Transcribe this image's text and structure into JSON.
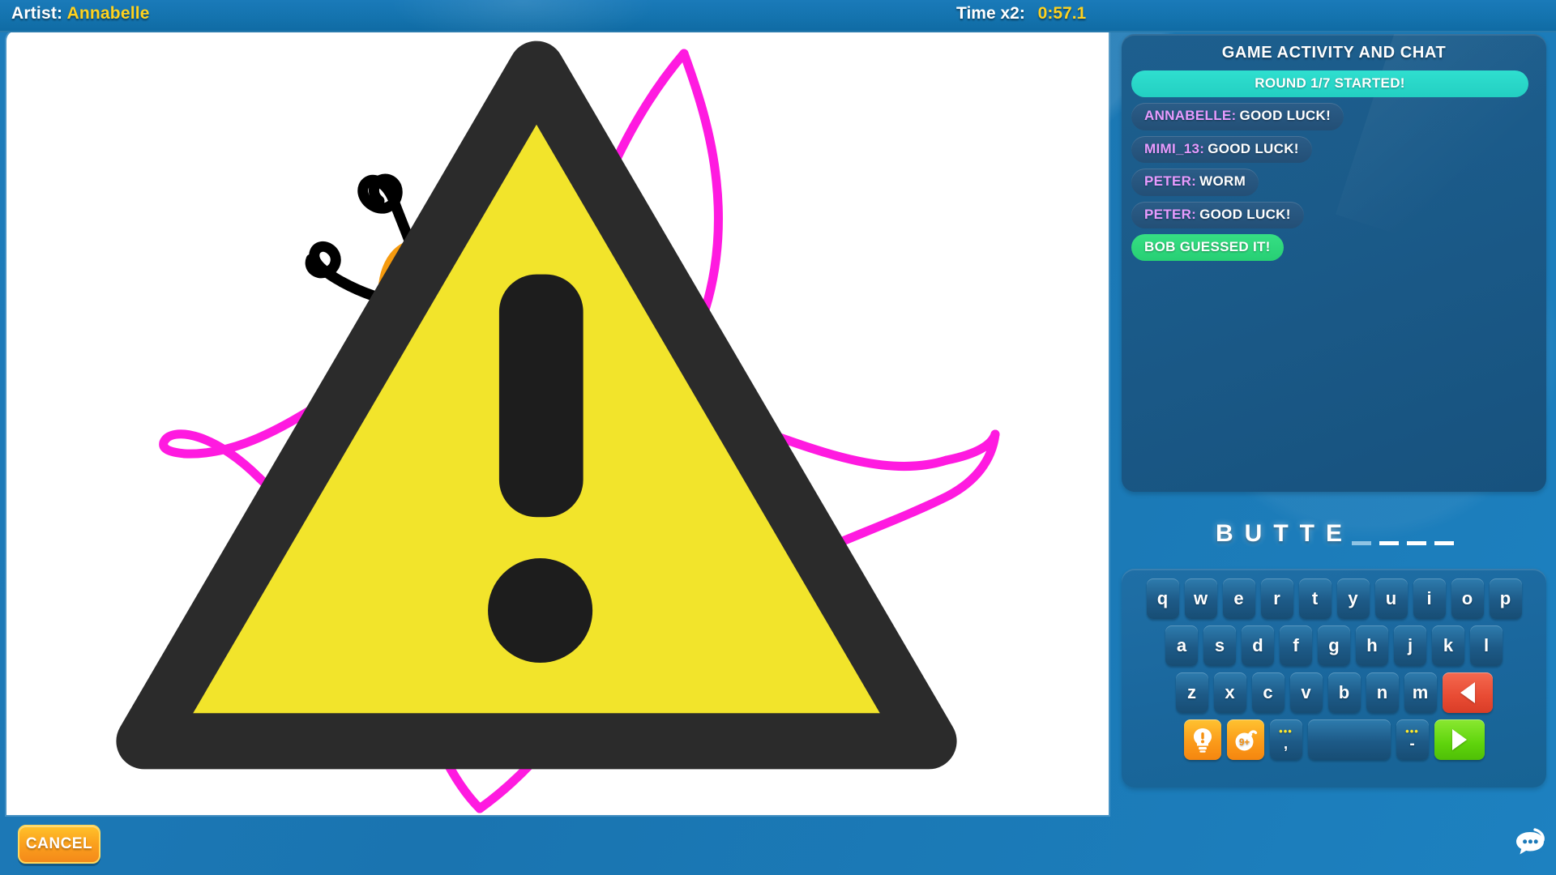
{
  "topbar": {
    "artist_label": "Artist:",
    "artist_name": "Annabelle",
    "time_label": "Time x2:",
    "time_value": "0:57.1"
  },
  "canvas": {
    "warning_icon": "warning-triangle-icon",
    "drawing_subject": "butterfly",
    "colors": {
      "wings": "#ff1ae0",
      "body": "#1ee3f0",
      "head": "#f59a0e",
      "antennae": "#000000",
      "segments": "#f59a0e",
      "background": "#ffffff"
    }
  },
  "cancel": {
    "label": "CANCEL"
  },
  "chat": {
    "title": "GAME ACTIVITY AND CHAT",
    "messages": [
      {
        "type": "system",
        "who": "",
        "text": "ROUND 1/7 STARTED!"
      },
      {
        "type": "msg",
        "who": "ANNABELLE:",
        "text": "GOOD LUCK!"
      },
      {
        "type": "msg",
        "who": "MIMI_13:",
        "text": "GOOD LUCK!"
      },
      {
        "type": "msg",
        "who": "PETER:",
        "text": "WORM"
      },
      {
        "type": "msg",
        "who": "PETER:",
        "text": "GOOD LUCK!"
      },
      {
        "type": "success",
        "who": "",
        "text": "BOB GUESSED IT!"
      }
    ],
    "colors": {
      "system": "#2bd8c9",
      "success": "#2fd87c",
      "username": "#e79bff"
    }
  },
  "word": {
    "revealed": [
      "B",
      "U",
      "T",
      "T",
      "E"
    ],
    "blanks": 4,
    "active_blank_index": 0
  },
  "keyboard": {
    "row1": [
      "q",
      "w",
      "e",
      "r",
      "t",
      "y",
      "u",
      "i",
      "o",
      "p"
    ],
    "row2": [
      "a",
      "s",
      "d",
      "f",
      "g",
      "h",
      "j",
      "k",
      "l"
    ],
    "row3": [
      "z",
      "x",
      "c",
      "v",
      "b",
      "n",
      "m"
    ],
    "backspace_icon": "backspace-triangle-icon",
    "hint_icon": "lightbulb-hint-icon",
    "bomb_label": "9+",
    "bomb_icon": "bomb-icon",
    "comma_key": ",",
    "comma_dots": "•••",
    "space_label": "",
    "hyphen_key": "-",
    "hyphen_dots": "•••",
    "enter_icon": "submit-triangle-icon"
  },
  "fab": {
    "icon": "chat-bubble-icon"
  }
}
